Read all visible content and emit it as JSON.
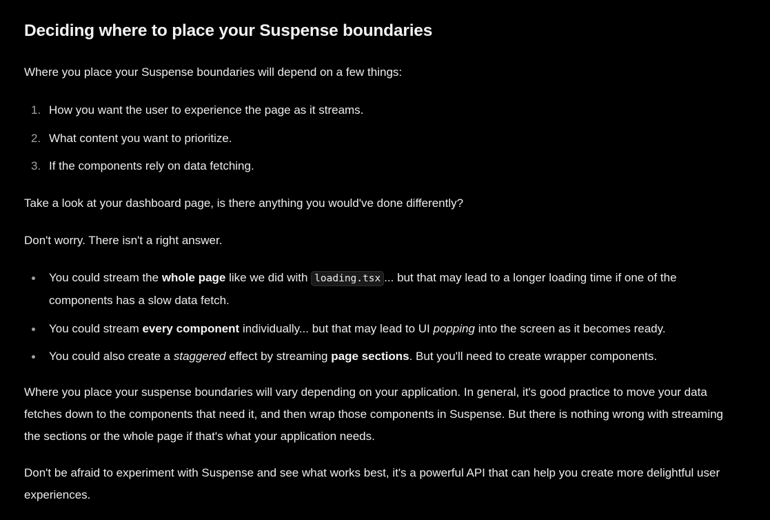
{
  "heading": "Deciding where to place your Suspense boundaries",
  "intro": "Where you place your Suspense boundaries will depend on a few things:",
  "ordered_list": [
    {
      "number": "1.",
      "text": "How you want the user to experience the page as it streams."
    },
    {
      "number": "2.",
      "text": "What content you want to prioritize."
    },
    {
      "number": "3.",
      "text": "If the components rely on data fetching."
    }
  ],
  "question": "Take a look at your dashboard page, is there anything you would've done differently?",
  "reassurance": "Don't worry. There isn't a right answer.",
  "bullets": [
    {
      "before": "You could stream the ",
      "bold": "whole page",
      "middle": " like we did with ",
      "code": "loading.tsx",
      "after": "... but that may lead to a longer loading time if one of the components has a slow data fetch."
    },
    {
      "before": "You could stream ",
      "bold": "every component",
      "middle": " individually... but that may lead to UI ",
      "italic": "popping",
      "after": " into the screen as it becomes ready."
    },
    {
      "before": "You could also create a ",
      "italic": "staggered",
      "middle": " effect by streaming ",
      "bold": "page sections",
      "after": ". But you'll need to create wrapper components."
    }
  ],
  "conclusion": "Where you place your suspense boundaries will vary depending on your application. In general, it's good practice to move your data fetches down to the components that need it, and then wrap those components in Suspense. But there is nothing wrong with streaming the sections or the whole page if that's what your application needs.",
  "closing": "Don't be afraid to experiment with Suspense and see what works best, it's a powerful API that can help you create more delightful user experiences.",
  "colors": {
    "background": "#000000",
    "text": "#ededed",
    "muted": "#a1a1a1",
    "code_background": "#1a1a1a"
  }
}
